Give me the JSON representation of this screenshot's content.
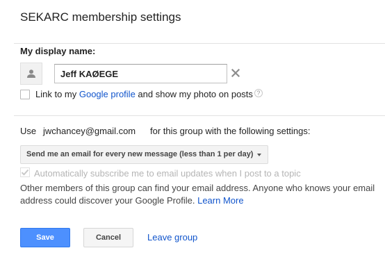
{
  "page": {
    "title": "SEKARC membership settings"
  },
  "display_name": {
    "label": "My display name:",
    "value": "Jeff KAØEGE",
    "avatar_icon": "person-icon",
    "clear_icon": "close-icon"
  },
  "profile_link": {
    "checked": false,
    "text_before": "Link to my ",
    "link_text": "Google profile",
    "text_after": " and show my photo on posts",
    "help_icon_text": "?"
  },
  "email_settings": {
    "use_label": "Use",
    "email": "jwchancey@gmail.com",
    "suffix": "for this group with the following settings:",
    "delivery_option": "Send me an email for every new message (less than 1 per day)",
    "auto_subscribe_label": "Automatically subscribe me to email updates when I post to a topic",
    "auto_subscribe_checked": true,
    "auto_subscribe_disabled": true
  },
  "info": {
    "text": "Other members of this group can find your email address. Anyone who knows your email address could discover your Google Profile.",
    "learn_more": "Learn More"
  },
  "actions": {
    "save": "Save",
    "cancel": "Cancel",
    "leave": "Leave group"
  },
  "colors": {
    "primary_button": "#4d90fe",
    "link": "#1155cc"
  }
}
